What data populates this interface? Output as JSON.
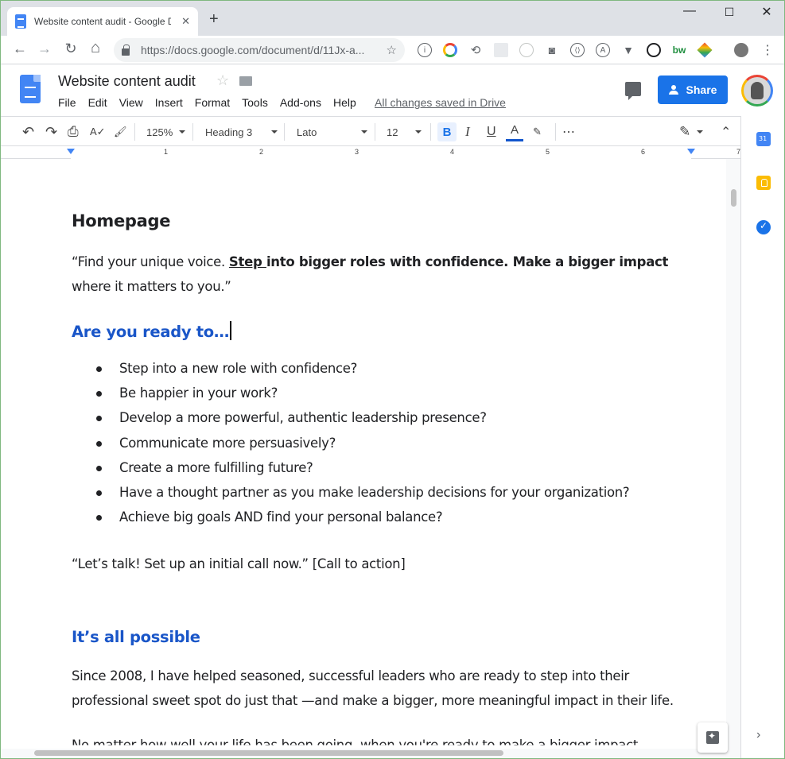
{
  "browser": {
    "tab_title": "Website content audit - Google D",
    "tab_close": "✕",
    "new_tab": "+",
    "url": "https://docs.google.com/document/d/11Jx-a...",
    "window_controls": [
      "—",
      "☐",
      "✕"
    ],
    "nav": {
      "back": "←",
      "forward": "→",
      "reload": "↻",
      "home": "⌂"
    },
    "extensions": [
      "info-icon",
      "color-wheel-icon",
      "sync-icon",
      "grid-icon",
      "timer-icon",
      "camera-icon",
      "code-icon",
      "a-circle-icon",
      "vee-icon",
      "g-circle-icon",
      "bw-icon",
      "gem-icon",
      "profile-icon",
      "menu-dots-icon"
    ],
    "ext_bw_label": "bw",
    "ext_a_label": "A"
  },
  "docs": {
    "title": "Website content audit",
    "menu": [
      "File",
      "Edit",
      "View",
      "Insert",
      "Format",
      "Tools",
      "Add-ons",
      "Help"
    ],
    "save_status": "All changes saved in Drive",
    "share_label": "Share"
  },
  "toolbar": {
    "zoom": "125%",
    "style": "Heading 3",
    "font": "Lato",
    "font_size": "12",
    "bold": "B",
    "italic": "I",
    "underline": "U",
    "text_color": "A",
    "more": "⋯",
    "undo": "↶",
    "redo": "↷",
    "print": "⎙",
    "spell": "A✓",
    "paint": "🖌",
    "pen": "✎",
    "collapse": "⌃"
  },
  "ruler": {
    "numbers": [
      "1",
      "2",
      "3",
      "4",
      "5",
      "6",
      "7"
    ]
  },
  "document": {
    "heading1": "Homepage",
    "quote_part1": "“Find your unique voice. ",
    "quote_underlined": "Step ",
    "quote_bold": "into bigger roles with confidence. Make a bigger impact",
    "quote_part2": " where it matters to you.”",
    "heading2": "Are you ready to…",
    "bullets": [
      "Step into a new role with confidence?",
      "Be happier in your work?",
      "Develop a more powerful, authentic leadership presence?",
      "Communicate more persuasively?",
      "Create a more fulfilling future?",
      "Have a thought partner as you make leadership decisions for your organization?",
      "Achieve big goals AND find your personal balance?"
    ],
    "cta": "“Let’s talk! Set up an initial call now.” [Call to action]",
    "heading3": "It’s all possible",
    "paragraph": "Since 2008, I have helped seasoned, successful leaders who are ready to step into their professional sweet spot do just that —and make a bigger, more meaningful impact in their life.",
    "cutoff_line": "No matter how well your life has been going, when you're ready to make a bigger impact"
  },
  "colors": {
    "accent_blue": "#1a73e8",
    "heading_blue": "#1a56c8"
  }
}
